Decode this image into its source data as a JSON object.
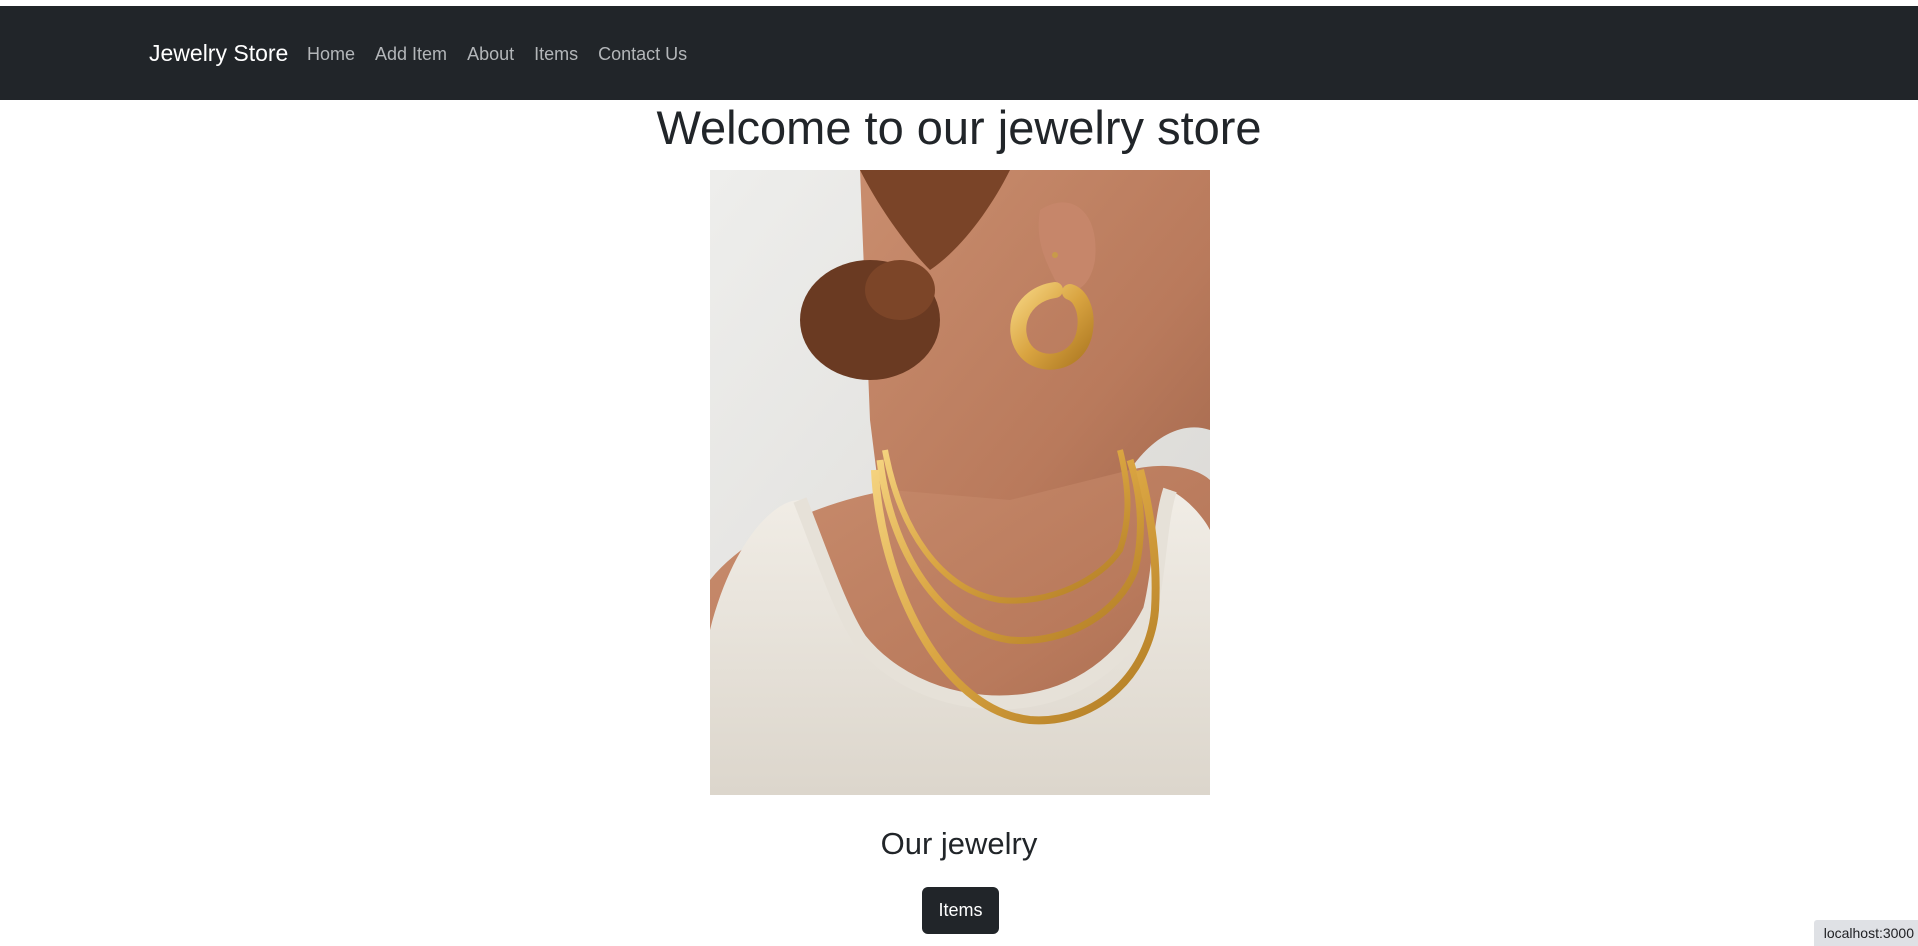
{
  "navbar": {
    "brand": "Jewelry Store",
    "links": [
      {
        "label": "Home"
      },
      {
        "label": "Add Item"
      },
      {
        "label": "About"
      },
      {
        "label": "Items"
      },
      {
        "label": "Contact Us"
      }
    ]
  },
  "main": {
    "title": "Welcome to our jewelry store",
    "hero_image": {
      "alt": "Woman wearing gold hoop earring and layered gold chain necklaces"
    },
    "subtitle": "Our jewelry",
    "items_button_label": "Items"
  },
  "status_bar": {
    "url": "localhost:3000"
  },
  "colors": {
    "navbar_bg": "#212529",
    "nav_link": "#b3b6b9",
    "button_bg": "#212529",
    "gold": "#d9a441"
  }
}
